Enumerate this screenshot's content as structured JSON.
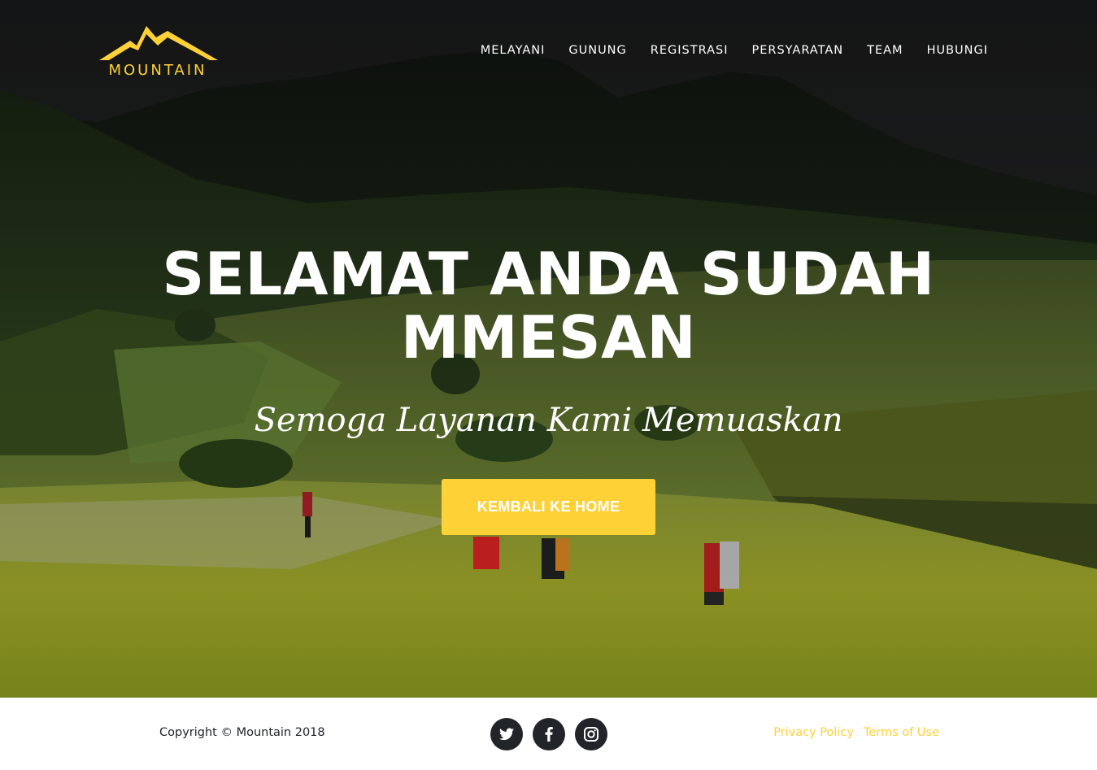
{
  "brand": {
    "name": "MOUNTAIN",
    "accent_color": "#fed136",
    "logo_icon": "mountain-peaks-icon"
  },
  "nav": {
    "items": [
      {
        "label": "MELAYANI"
      },
      {
        "label": "GUNUNG"
      },
      {
        "label": "REGISTRASI"
      },
      {
        "label": "PERSYARATAN"
      },
      {
        "label": "TEAM"
      },
      {
        "label": "HUBUNGI"
      }
    ]
  },
  "hero": {
    "heading_line1": "SELAMAT ANDA SUDAH",
    "heading_line2": "MMESAN",
    "subheading": "Semoga Layanan Kami Memuaskan",
    "button_label": "KEMBALI KE HOME",
    "background": "mountain-meadow-hikers-photo"
  },
  "footer": {
    "copyright": "Copyright © Mountain 2018",
    "socials": [
      {
        "icon": "twitter-icon"
      },
      {
        "icon": "facebook-icon"
      },
      {
        "icon": "instagram-icon"
      }
    ],
    "links": [
      {
        "label": "Privacy Policy"
      },
      {
        "label": "Terms of Use"
      }
    ]
  }
}
